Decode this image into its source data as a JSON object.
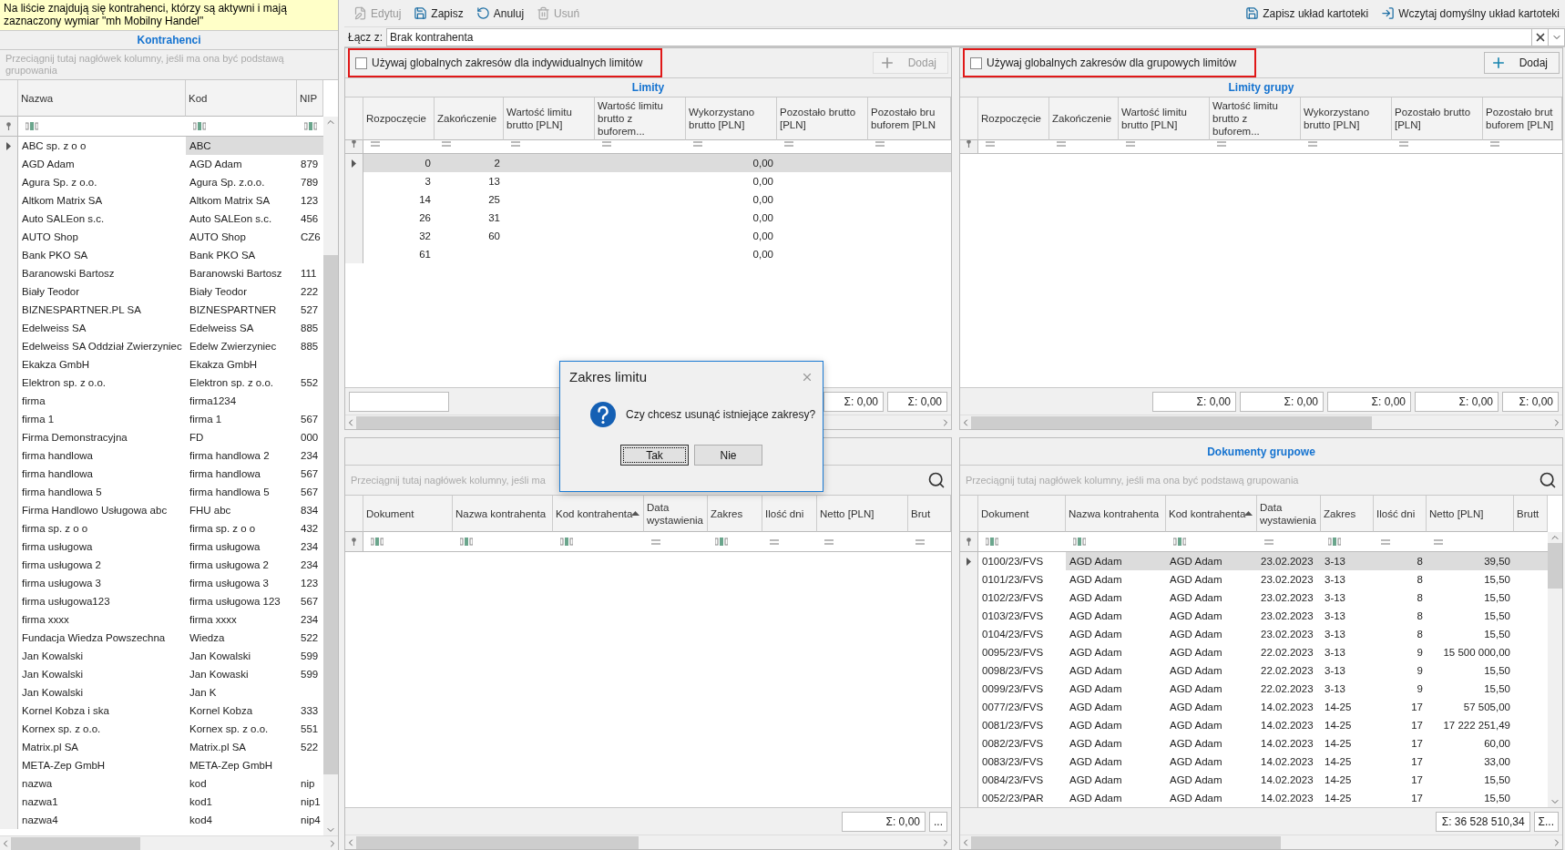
{
  "notice": "Na liście znajdują się kontrahenci, którzy są aktywni i mają zaznaczony wymiar \"mh Mobilny Handel\"",
  "contractors": {
    "title": "Kontrahenci",
    "group_hint": "Przeciągnij tutaj nagłówek kolumny, jeśli ma ona być podstawą grupowania",
    "columns": [
      {
        "label": "Nazwa"
      },
      {
        "label": "Kod"
      },
      {
        "label": "NIP"
      }
    ],
    "filters": [
      {
        "kind": "text"
      },
      {
        "kind": "text"
      },
      {
        "kind": "text"
      }
    ],
    "rows": [
      {
        "name": "ABC sp. z o o",
        "code": "ABC",
        "selected": true
      },
      {
        "name": "AGD Adam",
        "code": "AGD Adam",
        "nip": "879",
        "selected": false
      },
      {
        "name": "Agura Sp. z o.o.",
        "code": "Agura Sp. z.o.o.",
        "nip": "789",
        "selected": false
      },
      {
        "name": "Altkom Matrix SA",
        "code": "Altkom Matrix SA",
        "nip": "123",
        "selected": false
      },
      {
        "name": "Auto SALEon s.c.",
        "code": "Auto SALEon s.c.",
        "nip": "456",
        "selected": false
      },
      {
        "name": "AUTO Shop",
        "code": "AUTO Shop",
        "nip": "CZ6",
        "selected": false
      },
      {
        "name": "Bank PKO SA",
        "code": "Bank PKO SA",
        "selected": false
      },
      {
        "name": "Baranowski Bartosz",
        "code": "Baranowski Bartosz",
        "nip": "111",
        "selected": false
      },
      {
        "name": "Biały Teodor",
        "code": "Biały Teodor",
        "nip": "222",
        "selected": false
      },
      {
        "name": "BIZNESPARTNER.PL SA",
        "code": "BIZNESPARTNER",
        "nip": "527",
        "selected": false
      },
      {
        "name": "Edelweiss SA",
        "code": "Edelweiss SA",
        "nip": "885",
        "selected": false
      },
      {
        "name": "Edelweiss SA Oddział Zwierzyniec",
        "code": "Edelw Zwierzyniec",
        "nip": "885",
        "selected": false
      },
      {
        "name": "Ekakza GmbH",
        "code": "Ekakza GmbH",
        "selected": false
      },
      {
        "name": "Elektron sp. z o.o.",
        "code": "Elektron sp. z o.o.",
        "nip": "552",
        "selected": false
      },
      {
        "name": "firma",
        "code": "firma1234",
        "selected": false
      },
      {
        "name": "firma 1",
        "code": "firma 1",
        "nip": "567",
        "selected": false
      },
      {
        "name": "Firma Demonstracyjna",
        "code": "FD",
        "nip": "000",
        "selected": false
      },
      {
        "name": "firma handlowa",
        "code": "firma handlowa 2",
        "nip": "234",
        "selected": false
      },
      {
        "name": "firma handlowa",
        "code": "firma handlowa",
        "nip": "567",
        "selected": false
      },
      {
        "name": "firma handlowa 5",
        "code": "firma handlowa 5",
        "nip": "567",
        "selected": false
      },
      {
        "name": "Firma Handlowo Usługowa abc",
        "code": "FHU abc",
        "nip": "834",
        "selected": false
      },
      {
        "name": "firma sp. z o o",
        "code": "firma sp. z o o",
        "nip": "432",
        "selected": false
      },
      {
        "name": "firma usługowa",
        "code": "firma usługowa",
        "nip": "234",
        "selected": false
      },
      {
        "name": "firma usługowa 2",
        "code": "firma usługowa 2",
        "nip": "234",
        "selected": false
      },
      {
        "name": "firma usługowa 3",
        "code": "firma usługowa 3",
        "nip": "123",
        "selected": false
      },
      {
        "name": "firma usługowa123",
        "code": "firma usługowa 123",
        "nip": "567",
        "selected": false
      },
      {
        "name": "firma xxxx",
        "code": "firma xxxx",
        "nip": "234",
        "selected": false
      },
      {
        "name": "Fundacja Wiedza Powszechna",
        "code": "Wiedza",
        "nip": "522",
        "selected": false
      },
      {
        "name": "Jan Kowalski",
        "code": "Jan Kowalski",
        "nip": "599",
        "selected": false
      },
      {
        "name": "Jan Kowalski",
        "code": "Jan Kowaski",
        "nip": "599",
        "selected": false
      },
      {
        "name": "Jan Kowalski",
        "code": "Jan K",
        "selected": false
      },
      {
        "name": "Kornel Kobza i ska",
        "code": "Kornel Kobza",
        "nip": "333",
        "selected": false
      },
      {
        "name": "Kornex sp. z o.o.",
        "code": "Kornex sp. z o.o.",
        "nip": "551",
        "selected": false
      },
      {
        "name": "Matrix.pl SA",
        "code": "Matrix.pl SA",
        "nip": "522",
        "selected": false
      },
      {
        "name": "META-Zep GmbH",
        "code": "META-Zep GmbH",
        "selected": false
      },
      {
        "name": "nazwa",
        "code": "kod",
        "nip": "nip",
        "selected": false
      },
      {
        "name": "nazwa1",
        "code": "kod1",
        "nip": "nip1",
        "selected": false
      },
      {
        "name": "nazwa4",
        "code": "kod4",
        "nip": "nip4",
        "selected": false
      }
    ]
  },
  "toolbar": [
    {
      "kind": "edit",
      "label": "Edytuj",
      "disabled": true
    },
    {
      "kind": "save",
      "label": "Zapisz",
      "disabled": false
    },
    {
      "kind": "undo",
      "label": "Anuluj",
      "disabled": false
    },
    {
      "kind": "delete",
      "label": "Usuń",
      "disabled": true
    }
  ],
  "layout_toolbar": [
    {
      "kind": "save",
      "label": "Zapisz układ kartoteki"
    },
    {
      "kind": "load",
      "label": "Wczytaj domyślny układ kartoteki"
    }
  ],
  "link": {
    "label": "Łącz z:",
    "value": "Brak kontrahenta"
  },
  "limits": {
    "checkbox": {
      "label": "Używaj globalnych zakresów dla indywidualnych limitów",
      "checked": false
    },
    "add_button": {
      "label": "Dodaj",
      "disabled": true
    },
    "title": "Limity",
    "columns": [
      {
        "label": "Rozpoczęcie"
      },
      {
        "label": "Zakończenie"
      },
      {
        "label": "Wartość limitu brutto [PLN]"
      },
      {
        "label": "Wartość limitu brutto z buforem..."
      },
      {
        "label": "Wykorzystano brutto [PLN]"
      },
      {
        "label": "Pozostało brutto [PLN]"
      },
      {
        "label": "Pozostało bru buforem [PLN"
      }
    ],
    "rows": [
      {
        "start": "0",
        "end": "2",
        "used": "0,00",
        "selected": true
      },
      {
        "start": "3",
        "end": "13",
        "used": "0,00",
        "selected": false
      },
      {
        "start": "14",
        "end": "25",
        "used": "0,00",
        "selected": false
      },
      {
        "start": "26",
        "end": "31",
        "used": "0,00",
        "selected": false
      },
      {
        "start": "32",
        "end": "60",
        "used": "0,00",
        "selected": false
      },
      {
        "start": "61",
        "used": "0,00",
        "selected": false
      }
    ],
    "totals": [
      "Σ: 0,00",
      "Σ: 0,00"
    ]
  },
  "group_limits": {
    "checkbox": {
      "label": "Używaj globalnych zakresów dla grupowych limitów",
      "checked": false
    },
    "add_button": {
      "label": "Dodaj",
      "disabled": false
    },
    "title": "Limity grupy",
    "columns": [
      {
        "label": "Rozpoczęcie"
      },
      {
        "label": "Zakończenie"
      },
      {
        "label": "Wartość limitu brutto [PLN]"
      },
      {
        "label": "Wartość limitu brutto z buforem..."
      },
      {
        "label": "Wykorzystano brutto [PLN]"
      },
      {
        "label": "Pozostało brutto [PLN]"
      },
      {
        "label": "Pozostało brut buforem [PLN]"
      }
    ],
    "totals": [
      "Σ: 0,00",
      "Σ: 0,00",
      "Σ: 0,00",
      "Σ: 0,00",
      "Σ: 0,00"
    ]
  },
  "documents": {
    "group_hint": "Przeciągnij tutaj nagłówek kolumny, jeśli ma",
    "columns": [
      {
        "label": "Dokument",
        "sorted": false
      },
      {
        "label": "Nazwa kontrahenta",
        "sorted": false
      },
      {
        "label": "Kod kontrahenta",
        "sorted": true
      },
      {
        "label": "Data wystawienia",
        "sorted": false
      },
      {
        "label": "Zakres",
        "sorted": false
      },
      {
        "label": "Ilość dni",
        "sorted": false
      },
      {
        "label": "Netto [PLN]",
        "sorted": false
      },
      {
        "label": "Brut",
        "sorted": false
      }
    ],
    "filters": [
      {
        "kind": "text"
      },
      {
        "kind": "text"
      },
      {
        "kind": "text"
      },
      {
        "kind": "equals"
      },
      {
        "kind": "text"
      },
      {
        "kind": "equals"
      },
      {
        "kind": "equals"
      },
      {
        "kind": "equals"
      }
    ],
    "total": "Σ: 0,00",
    "more": "..."
  },
  "group_documents": {
    "title": "Dokumenty grupowe",
    "group_hint": "Przeciągnij tutaj nagłówek kolumny, jeśli ma ona być podstawą grupowania",
    "columns": [
      {
        "label": "Dokument",
        "sorted": false
      },
      {
        "label": "Nazwa kontrahenta",
        "sorted": false
      },
      {
        "label": "Kod kontrahenta",
        "sorted": true
      },
      {
        "label": "Data wystawienia",
        "sorted": false
      },
      {
        "label": "Zakres",
        "sorted": false
      },
      {
        "label": "Ilość dni",
        "sorted": false
      },
      {
        "label": "Netto [PLN]",
        "sorted": false
      },
      {
        "label": "Brutt",
        "sorted": false
      }
    ],
    "filters": [
      {
        "kind": "text"
      },
      {
        "kind": "text"
      },
      {
        "kind": "text"
      },
      {
        "kind": "equals"
      },
      {
        "kind": "text"
      },
      {
        "kind": "equals"
      },
      {
        "kind": "equals"
      }
    ],
    "rows": [
      {
        "document": "0100/23/FVS",
        "name": "AGD Adam",
        "code": "AGD Adam",
        "date": "23.02.2023",
        "range": "3-13",
        "days": "8",
        "net": "39,50",
        "selected": true
      },
      {
        "document": "0101/23/FVS",
        "name": "AGD Adam",
        "code": "AGD Adam",
        "date": "23.02.2023",
        "range": "3-13",
        "days": "8",
        "net": "15,50",
        "selected": false
      },
      {
        "document": "0102/23/FVS",
        "name": "AGD Adam",
        "code": "AGD Adam",
        "date": "23.02.2023",
        "range": "3-13",
        "days": "8",
        "net": "15,50",
        "selected": false
      },
      {
        "document": "0103/23/FVS",
        "name": "AGD Adam",
        "code": "AGD Adam",
        "date": "23.02.2023",
        "range": "3-13",
        "days": "8",
        "net": "15,50",
        "selected": false
      },
      {
        "document": "0104/23/FVS",
        "name": "AGD Adam",
        "code": "AGD Adam",
        "date": "23.02.2023",
        "range": "3-13",
        "days": "8",
        "net": "15,50",
        "selected": false
      },
      {
        "document": "0095/23/FVS",
        "name": "AGD Adam",
        "code": "AGD Adam",
        "date": "22.02.2023",
        "range": "3-13",
        "days": "9",
        "net": "15 500 000,00",
        "selected": false
      },
      {
        "document": "0098/23/FVS",
        "name": "AGD Adam",
        "code": "AGD Adam",
        "date": "22.02.2023",
        "range": "3-13",
        "days": "9",
        "net": "15,50",
        "selected": false
      },
      {
        "document": "0099/23/FVS",
        "name": "AGD Adam",
        "code": "AGD Adam",
        "date": "22.02.2023",
        "range": "3-13",
        "days": "9",
        "net": "15,50",
        "selected": false
      },
      {
        "document": "0077/23/FVS",
        "name": "AGD Adam",
        "code": "AGD Adam",
        "date": "14.02.2023",
        "range": "14-25",
        "days": "17",
        "net": "57 505,00",
        "selected": false
      },
      {
        "document": "0081/23/FVS",
        "name": "AGD Adam",
        "code": "AGD Adam",
        "date": "14.02.2023",
        "range": "14-25",
        "days": "17",
        "net": "17 222 251,49",
        "selected": false
      },
      {
        "document": "0082/23/FVS",
        "name": "AGD Adam",
        "code": "AGD Adam",
        "date": "14.02.2023",
        "range": "14-25",
        "days": "17",
        "net": "60,00",
        "selected": false
      },
      {
        "document": "0083/23/FVS",
        "name": "AGD Adam",
        "code": "AGD Adam",
        "date": "14.02.2023",
        "range": "14-25",
        "days": "17",
        "net": "33,00",
        "selected": false
      },
      {
        "document": "0084/23/FVS",
        "name": "AGD Adam",
        "code": "AGD Adam",
        "date": "14.02.2023",
        "range": "14-25",
        "days": "17",
        "net": "15,50",
        "selected": false
      },
      {
        "document": "0052/23/PAR",
        "name": "AGD Adam",
        "code": "AGD Adam",
        "date": "14.02.2023",
        "range": "14-25",
        "days": "17",
        "net": "15,50",
        "selected": false
      }
    ],
    "total": "Σ: 36 528 510,34",
    "more": "Σ..."
  },
  "dialog": {
    "title": "Zakres limitu",
    "message": "Czy chcesz usunąć istniejące zakresy?",
    "buttons": [
      {
        "label": "Tak",
        "selected": true
      },
      {
        "label": "Nie",
        "selected": false
      }
    ]
  }
}
